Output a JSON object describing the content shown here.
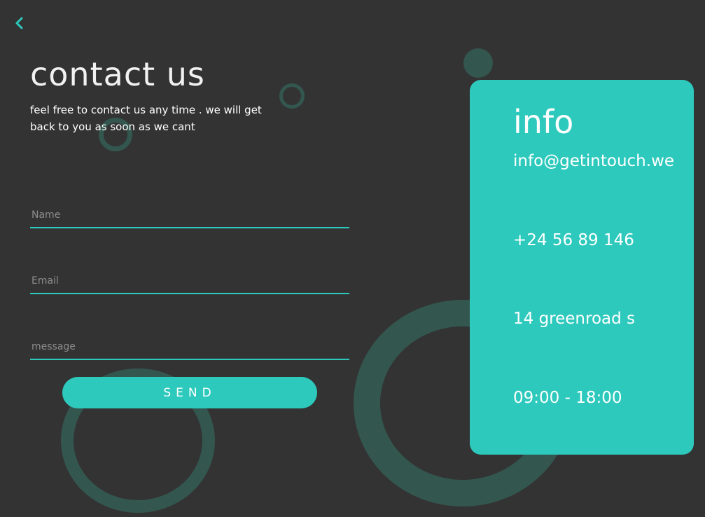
{
  "navigation": {
    "back_icon": "chevron-left-icon"
  },
  "header": {
    "title": "contact us",
    "subtitle": "feel free to contact us any time . we will get back to you as soon as we cant"
  },
  "form": {
    "name_placeholder": "Name",
    "name_value": "",
    "email_placeholder": "Email",
    "email_value": "",
    "message_placeholder": "message",
    "message_value": "",
    "send_label": "SEND"
  },
  "info": {
    "title": "info",
    "email": "info@getintouch.we",
    "phone": "+24 56 89 146",
    "address": "14 greenroad s",
    "hours": "09:00 - 18:00"
  },
  "colors": {
    "background": "#333333",
    "accent": "#2ec9bd",
    "decoration": "#33574f",
    "text": "#ffffff",
    "placeholder": "#8c8c8c"
  }
}
